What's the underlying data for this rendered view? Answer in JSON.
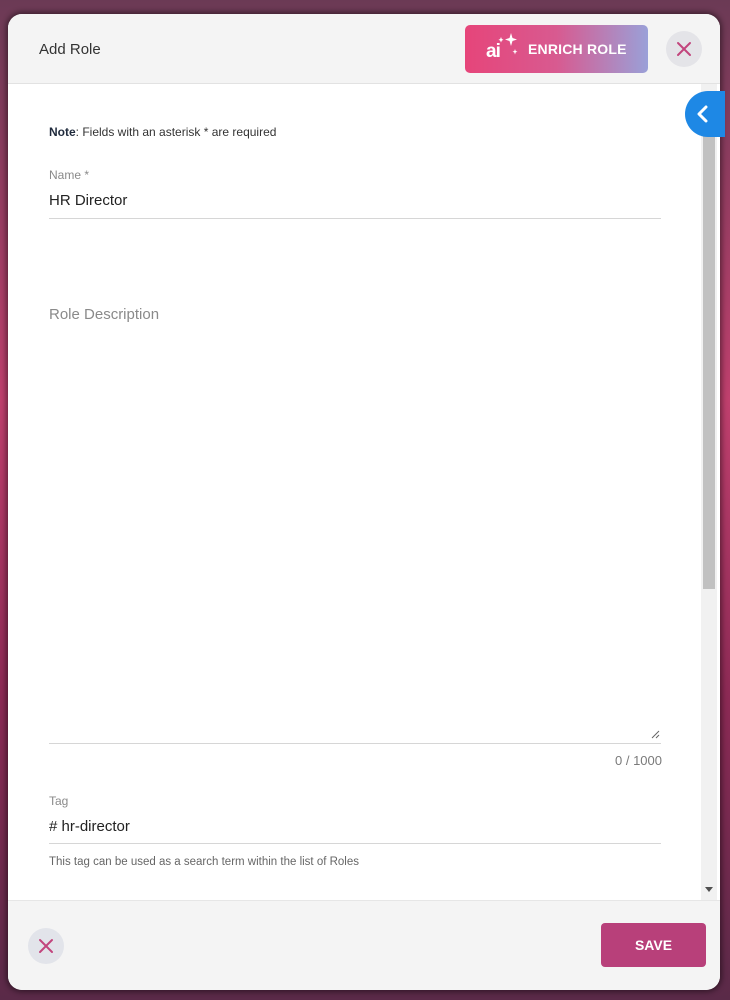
{
  "dialog": {
    "title": "Add Role",
    "enrich_button_label": "ENRICH ROLE",
    "ai_badge": "ai"
  },
  "note": {
    "bold": "Note",
    "text": ": Fields with an asterisk * are required"
  },
  "form": {
    "name": {
      "label": "Name *",
      "value": "HR Director"
    },
    "description": {
      "placeholder": "Role Description",
      "value": "",
      "counter": "0 / 1000"
    },
    "tag": {
      "label": "Tag",
      "value": "# hr-director",
      "hint": "This tag can be used as a search term within the list of Roles"
    }
  },
  "footer": {
    "save_label": "SAVE"
  },
  "icons": {
    "close": "close-icon",
    "sparkle": "sparkle-icon",
    "chevron": "chevron-left-icon"
  },
  "colors": {
    "accent": "#b8407a",
    "close_icon": "#c2457d",
    "side_toggle": "#1e88e5"
  }
}
